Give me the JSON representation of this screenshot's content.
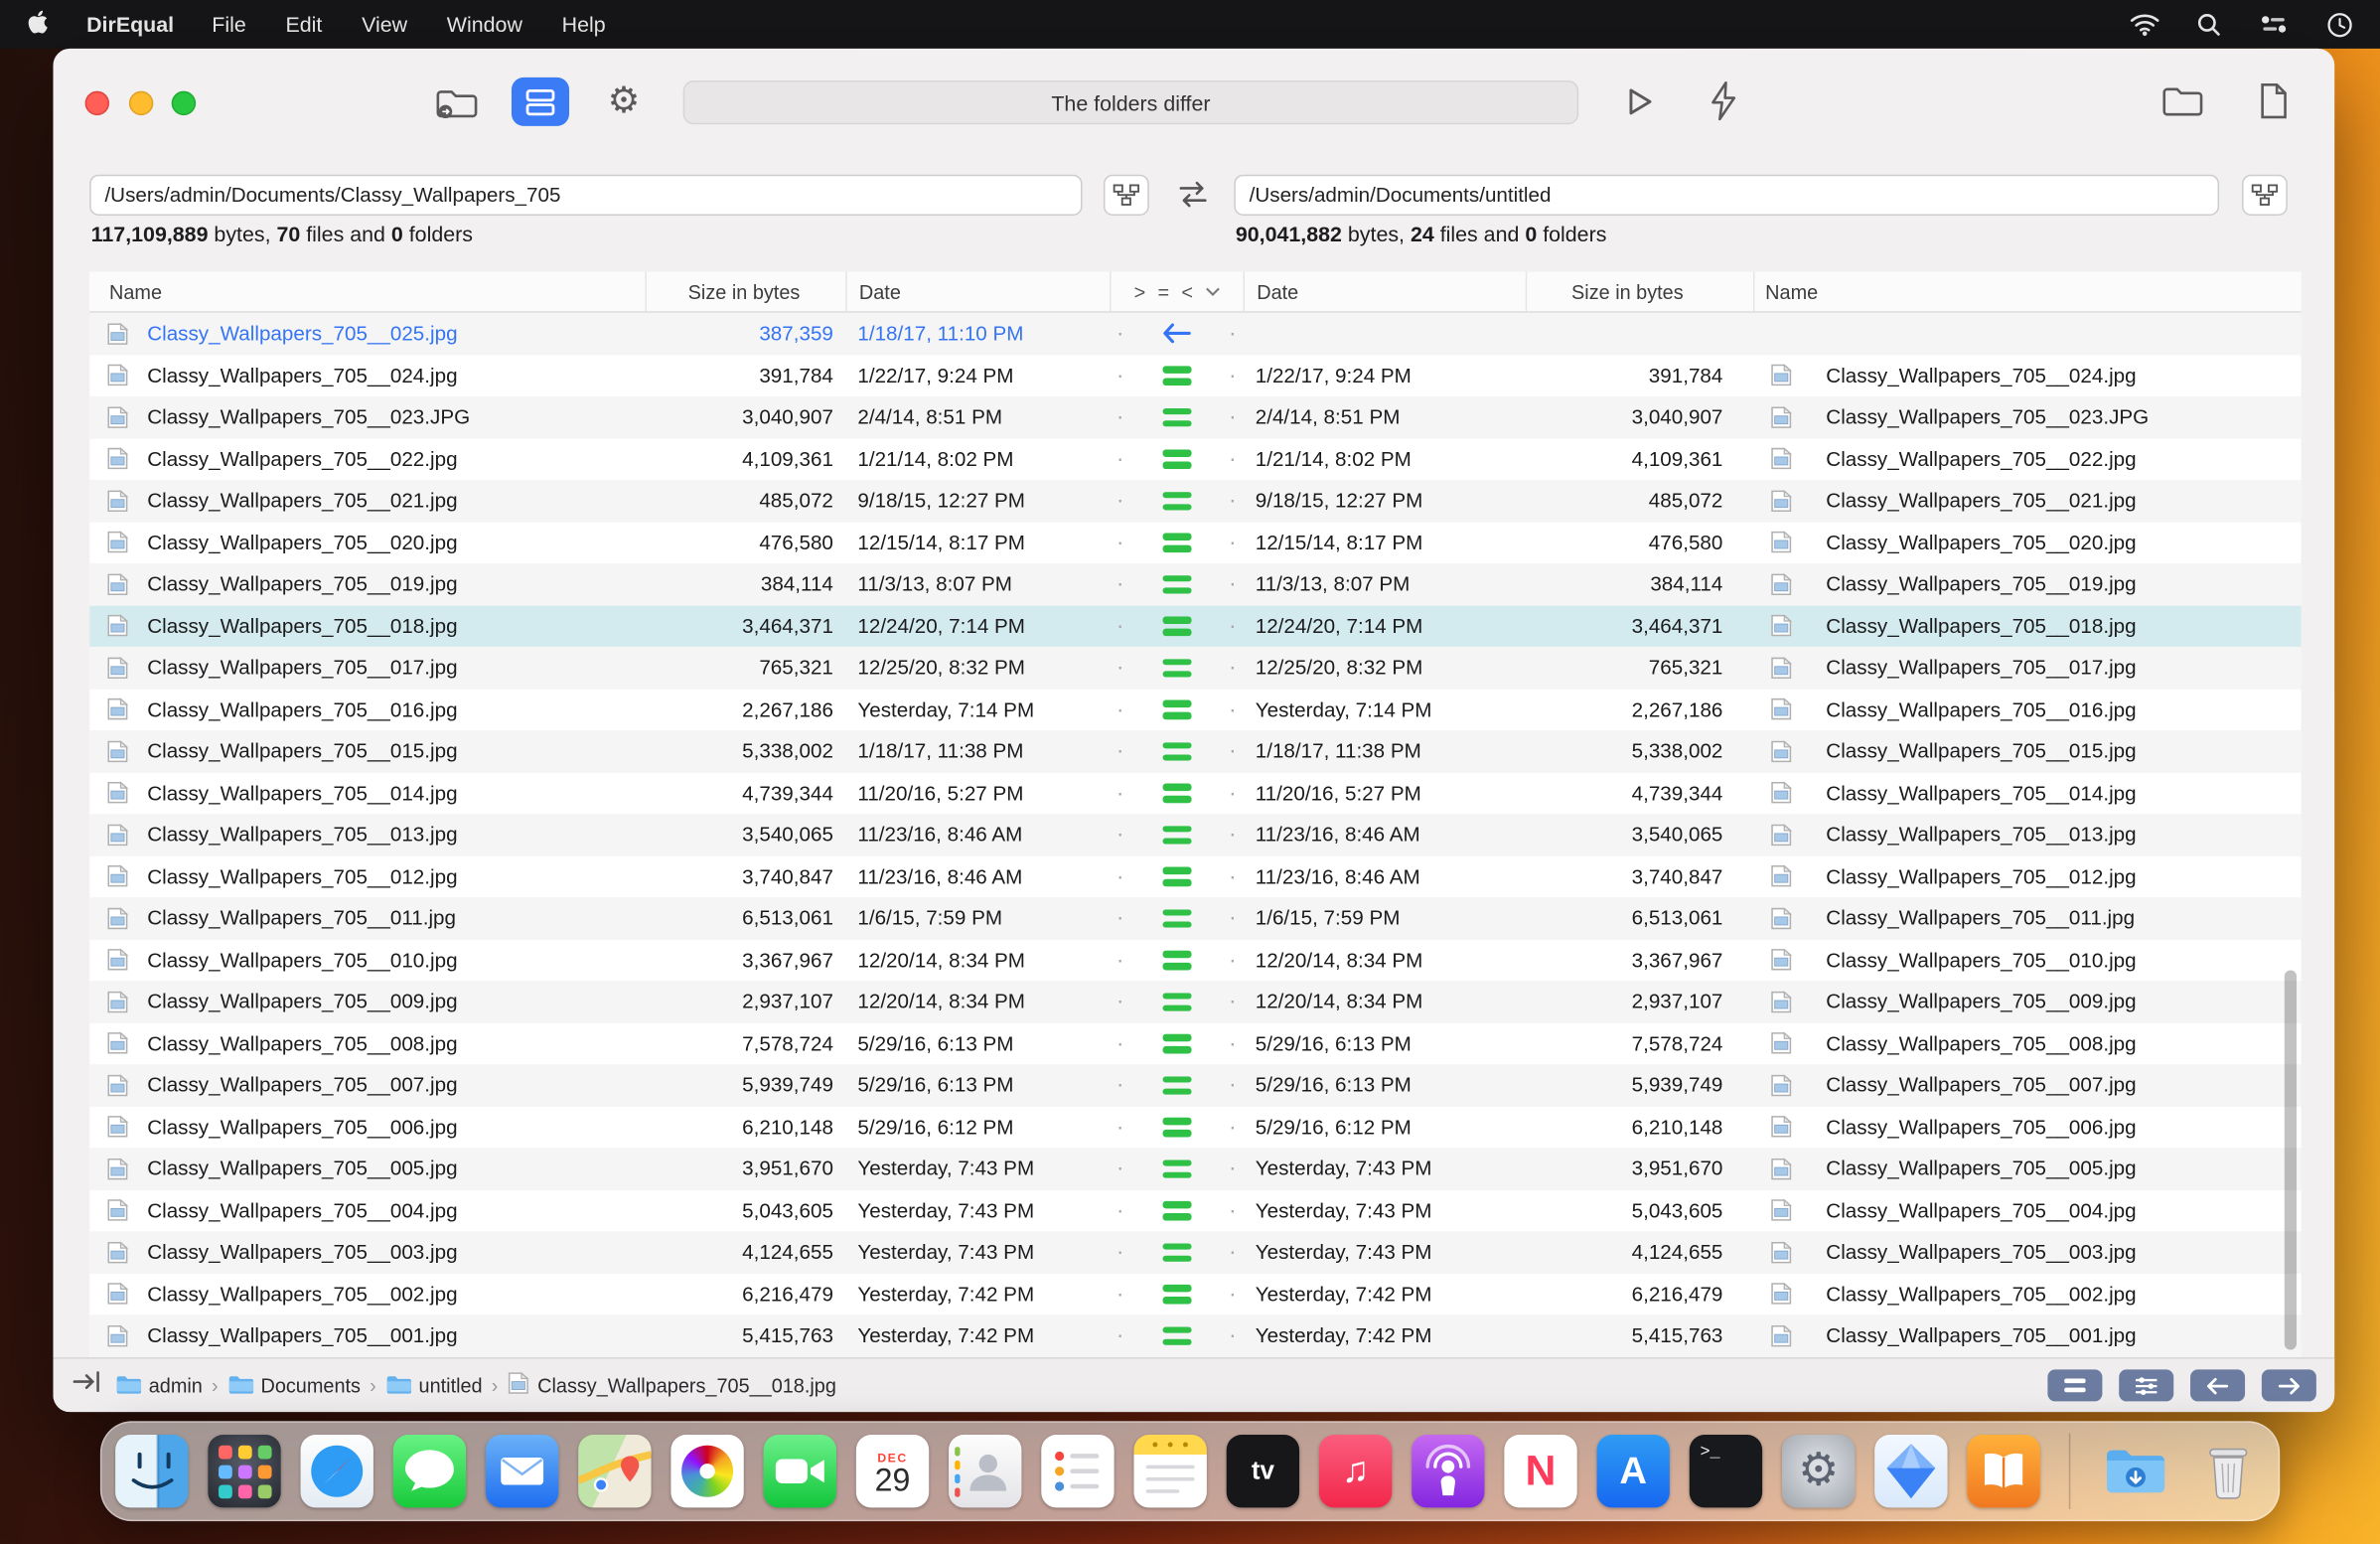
{
  "menu_bar": {
    "app_name": "DirEqual",
    "menus": [
      "File",
      "Edit",
      "View",
      "Window",
      "Help"
    ],
    "status_icons": [
      "wifi",
      "spotlight-search",
      "control-center",
      "clock"
    ]
  },
  "toolbar": {
    "status_text": "The folders differ"
  },
  "left_pane": {
    "path": "/Users/admin/Documents/Classy_Wallpapers_705",
    "bytes": "117,109,889",
    "bytes_word": " bytes, ",
    "files": "70",
    "files_word": " files and ",
    "folders": "0",
    "folders_word": " folders"
  },
  "right_pane": {
    "path": "/Users/admin/Documents/untitled",
    "bytes": "90,041,882",
    "bytes_word": " bytes, ",
    "files": "24",
    "files_word": " files and ",
    "folders": "0",
    "folders_word": " folders"
  },
  "table": {
    "headers": {
      "name_left": "Name",
      "size_left": "Size in bytes",
      "date_left": "Date",
      "gt": ">",
      "eq": "=",
      "lt": "<",
      "date_right": "Date",
      "size_right": "Size in bytes",
      "name_right": "Name"
    },
    "rows": [
      {
        "left": {
          "name": "Classy_Wallpapers_705__025.jpg",
          "size": "387,359",
          "date": "1/18/17, 11:10 PM"
        },
        "relation": "left_only",
        "right": {
          "date": "",
          "size": "",
          "name": ""
        },
        "selected": false
      },
      {
        "left": {
          "name": "Classy_Wallpapers_705__024.jpg",
          "size": "391,784",
          "date": "1/22/17, 9:24 PM"
        },
        "relation": "equal",
        "right": {
          "date": "1/22/17, 9:24 PM",
          "size": "391,784",
          "name": "Classy_Wallpapers_705__024.jpg"
        },
        "selected": false
      },
      {
        "left": {
          "name": "Classy_Wallpapers_705__023.JPG",
          "size": "3,040,907",
          "date": "2/4/14, 8:51 PM"
        },
        "relation": "equal",
        "right": {
          "date": "2/4/14, 8:51 PM",
          "size": "3,040,907",
          "name": "Classy_Wallpapers_705__023.JPG"
        },
        "selected": false
      },
      {
        "left": {
          "name": "Classy_Wallpapers_705__022.jpg",
          "size": "4,109,361",
          "date": "1/21/14, 8:02 PM"
        },
        "relation": "equal",
        "right": {
          "date": "1/21/14, 8:02 PM",
          "size": "4,109,361",
          "name": "Classy_Wallpapers_705__022.jpg"
        },
        "selected": false
      },
      {
        "left": {
          "name": "Classy_Wallpapers_705__021.jpg",
          "size": "485,072",
          "date": "9/18/15, 12:27 PM"
        },
        "relation": "equal",
        "right": {
          "date": "9/18/15, 12:27 PM",
          "size": "485,072",
          "name": "Classy_Wallpapers_705__021.jpg"
        },
        "selected": false
      },
      {
        "left": {
          "name": "Classy_Wallpapers_705__020.jpg",
          "size": "476,580",
          "date": "12/15/14, 8:17 PM"
        },
        "relation": "equal",
        "right": {
          "date": "12/15/14, 8:17 PM",
          "size": "476,580",
          "name": "Classy_Wallpapers_705__020.jpg"
        },
        "selected": false
      },
      {
        "left": {
          "name": "Classy_Wallpapers_705__019.jpg",
          "size": "384,114",
          "date": "11/3/13, 8:07 PM"
        },
        "relation": "equal",
        "right": {
          "date": "11/3/13, 8:07 PM",
          "size": "384,114",
          "name": "Classy_Wallpapers_705__019.jpg"
        },
        "selected": false
      },
      {
        "left": {
          "name": "Classy_Wallpapers_705__018.jpg",
          "size": "3,464,371",
          "date": "12/24/20, 7:14 PM"
        },
        "relation": "equal",
        "right": {
          "date": "12/24/20, 7:14 PM",
          "size": "3,464,371",
          "name": "Classy_Wallpapers_705__018.jpg"
        },
        "selected": true
      },
      {
        "left": {
          "name": "Classy_Wallpapers_705__017.jpg",
          "size": "765,321",
          "date": "12/25/20, 8:32 PM"
        },
        "relation": "equal",
        "right": {
          "date": "12/25/20, 8:32 PM",
          "size": "765,321",
          "name": "Classy_Wallpapers_705__017.jpg"
        },
        "selected": false
      },
      {
        "left": {
          "name": "Classy_Wallpapers_705__016.jpg",
          "size": "2,267,186",
          "date": "Yesterday, 7:14 PM"
        },
        "relation": "equal",
        "right": {
          "date": "Yesterday, 7:14 PM",
          "size": "2,267,186",
          "name": "Classy_Wallpapers_705__016.jpg"
        },
        "selected": false
      },
      {
        "left": {
          "name": "Classy_Wallpapers_705__015.jpg",
          "size": "5,338,002",
          "date": "1/18/17, 11:38 PM"
        },
        "relation": "equal",
        "right": {
          "date": "1/18/17, 11:38 PM",
          "size": "5,338,002",
          "name": "Classy_Wallpapers_705__015.jpg"
        },
        "selected": false
      },
      {
        "left": {
          "name": "Classy_Wallpapers_705__014.jpg",
          "size": "4,739,344",
          "date": "11/20/16, 5:27 PM"
        },
        "relation": "equal",
        "right": {
          "date": "11/20/16, 5:27 PM",
          "size": "4,739,344",
          "name": "Classy_Wallpapers_705__014.jpg"
        },
        "selected": false
      },
      {
        "left": {
          "name": "Classy_Wallpapers_705__013.jpg",
          "size": "3,540,065",
          "date": "11/23/16, 8:46 AM"
        },
        "relation": "equal",
        "right": {
          "date": "11/23/16, 8:46 AM",
          "size": "3,540,065",
          "name": "Classy_Wallpapers_705__013.jpg"
        },
        "selected": false
      },
      {
        "left": {
          "name": "Classy_Wallpapers_705__012.jpg",
          "size": "3,740,847",
          "date": "11/23/16, 8:46 AM"
        },
        "relation": "equal",
        "right": {
          "date": "11/23/16, 8:46 AM",
          "size": "3,740,847",
          "name": "Classy_Wallpapers_705__012.jpg"
        },
        "selected": false
      },
      {
        "left": {
          "name": "Classy_Wallpapers_705__011.jpg",
          "size": "6,513,061",
          "date": "1/6/15, 7:59 PM"
        },
        "relation": "equal",
        "right": {
          "date": "1/6/15, 7:59 PM",
          "size": "6,513,061",
          "name": "Classy_Wallpapers_705__011.jpg"
        },
        "selected": false
      },
      {
        "left": {
          "name": "Classy_Wallpapers_705__010.jpg",
          "size": "3,367,967",
          "date": "12/20/14, 8:34 PM"
        },
        "relation": "equal",
        "right": {
          "date": "12/20/14, 8:34 PM",
          "size": "3,367,967",
          "name": "Classy_Wallpapers_705__010.jpg"
        },
        "selected": false
      },
      {
        "left": {
          "name": "Classy_Wallpapers_705__009.jpg",
          "size": "2,937,107",
          "date": "12/20/14, 8:34 PM"
        },
        "relation": "equal",
        "right": {
          "date": "12/20/14, 8:34 PM",
          "size": "2,937,107",
          "name": "Classy_Wallpapers_705__009.jpg"
        },
        "selected": false
      },
      {
        "left": {
          "name": "Classy_Wallpapers_705__008.jpg",
          "size": "7,578,724",
          "date": "5/29/16, 6:13 PM"
        },
        "relation": "equal",
        "right": {
          "date": "5/29/16, 6:13 PM",
          "size": "7,578,724",
          "name": "Classy_Wallpapers_705__008.jpg"
        },
        "selected": false
      },
      {
        "left": {
          "name": "Classy_Wallpapers_705__007.jpg",
          "size": "5,939,749",
          "date": "5/29/16, 6:13 PM"
        },
        "relation": "equal",
        "right": {
          "date": "5/29/16, 6:13 PM",
          "size": "5,939,749",
          "name": "Classy_Wallpapers_705__007.jpg"
        },
        "selected": false
      },
      {
        "left": {
          "name": "Classy_Wallpapers_705__006.jpg",
          "size": "6,210,148",
          "date": "5/29/16, 6:12 PM"
        },
        "relation": "equal",
        "right": {
          "date": "5/29/16, 6:12 PM",
          "size": "6,210,148",
          "name": "Classy_Wallpapers_705__006.jpg"
        },
        "selected": false
      },
      {
        "left": {
          "name": "Classy_Wallpapers_705__005.jpg",
          "size": "3,951,670",
          "date": "Yesterday, 7:43 PM"
        },
        "relation": "equal",
        "right": {
          "date": "Yesterday, 7:43 PM",
          "size": "3,951,670",
          "name": "Classy_Wallpapers_705__005.jpg"
        },
        "selected": false
      },
      {
        "left": {
          "name": "Classy_Wallpapers_705__004.jpg",
          "size": "5,043,605",
          "date": "Yesterday, 7:43 PM"
        },
        "relation": "equal",
        "right": {
          "date": "Yesterday, 7:43 PM",
          "size": "5,043,605",
          "name": "Classy_Wallpapers_705__004.jpg"
        },
        "selected": false
      },
      {
        "left": {
          "name": "Classy_Wallpapers_705__003.jpg",
          "size": "4,124,655",
          "date": "Yesterday, 7:43 PM"
        },
        "relation": "equal",
        "right": {
          "date": "Yesterday, 7:43 PM",
          "size": "4,124,655",
          "name": "Classy_Wallpapers_705__003.jpg"
        },
        "selected": false
      },
      {
        "left": {
          "name": "Classy_Wallpapers_705__002.jpg",
          "size": "6,216,479",
          "date": "Yesterday, 7:42 PM"
        },
        "relation": "equal",
        "right": {
          "date": "Yesterday, 7:42 PM",
          "size": "6,216,479",
          "name": "Classy_Wallpapers_705__002.jpg"
        },
        "selected": false
      },
      {
        "left": {
          "name": "Classy_Wallpapers_705__001.jpg",
          "size": "5,415,763",
          "date": "Yesterday, 7:42 PM"
        },
        "relation": "equal",
        "right": {
          "date": "Yesterday, 7:42 PM",
          "size": "5,415,763",
          "name": "Classy_Wallpapers_705__001.jpg"
        },
        "selected": false
      }
    ]
  },
  "status_bar": {
    "separator": "›",
    "breadcrumb": [
      {
        "icon": "folder",
        "label": "admin"
      },
      {
        "icon": "folder",
        "label": "Documents"
      },
      {
        "icon": "folder",
        "label": "untitled"
      },
      {
        "icon": "file",
        "label": "Classy_Wallpapers_705__018.jpg"
      }
    ]
  },
  "dock": {
    "items": [
      {
        "kind": "finder"
      },
      {
        "kind": "launchpad"
      },
      {
        "kind": "safari"
      },
      {
        "kind": "messages"
      },
      {
        "kind": "mail"
      },
      {
        "kind": "maps"
      },
      {
        "kind": "photos"
      },
      {
        "kind": "facetime"
      },
      {
        "kind": "calendar",
        "month": "DEC",
        "day": "29"
      },
      {
        "kind": "contacts"
      },
      {
        "kind": "reminders"
      },
      {
        "kind": "notes"
      },
      {
        "kind": "tv"
      },
      {
        "kind": "music"
      },
      {
        "kind": "podcasts"
      },
      {
        "kind": "news"
      },
      {
        "kind": "appstore"
      },
      {
        "kind": "terminal"
      },
      {
        "kind": "settings"
      },
      {
        "kind": "direqual"
      },
      {
        "kind": "books"
      },
      {
        "kind": "separator"
      },
      {
        "kind": "downloads"
      },
      {
        "kind": "trash"
      }
    ]
  },
  "colors": {
    "accent_blue": "#3574f2",
    "equal_green": "#2fc046",
    "selected_row": "#d3ebee",
    "toolbar_button_blue": "#3b7cf6"
  }
}
